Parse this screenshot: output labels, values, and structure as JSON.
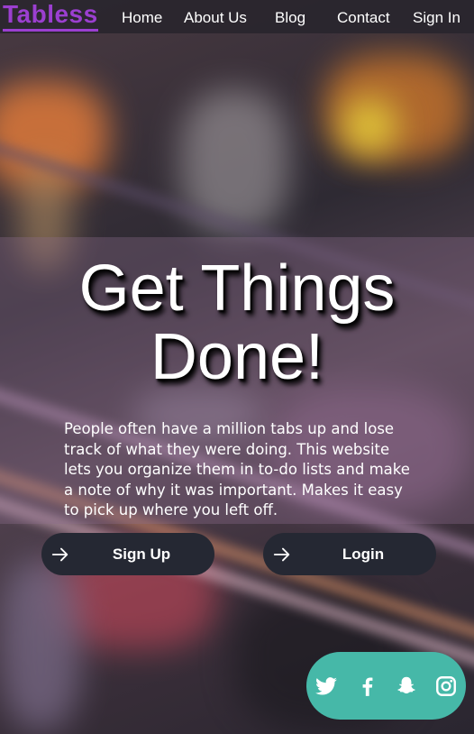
{
  "nav": {
    "logo": "Tabless",
    "items": [
      "Home",
      "About Us",
      "Blog",
      "Contact",
      "Sign In"
    ]
  },
  "hero": {
    "title_line1": "Get Things",
    "title_line2": "Done!",
    "description": "People often have a million tabs up and lose track of what they were doing. This website lets you organize them in to-do lists and make a note of why it was important. Makes it easy to pick up where you left off."
  },
  "buttons": {
    "signup": "Sign Up",
    "login": "Login"
  },
  "social": {
    "icons": [
      "twitter-icon",
      "facebook-icon",
      "snapchat-icon",
      "instagram-icon"
    ]
  },
  "colors": {
    "brand": "#9b3fd0",
    "button_bg": "#252833",
    "social_bg": "#46b8a8"
  }
}
